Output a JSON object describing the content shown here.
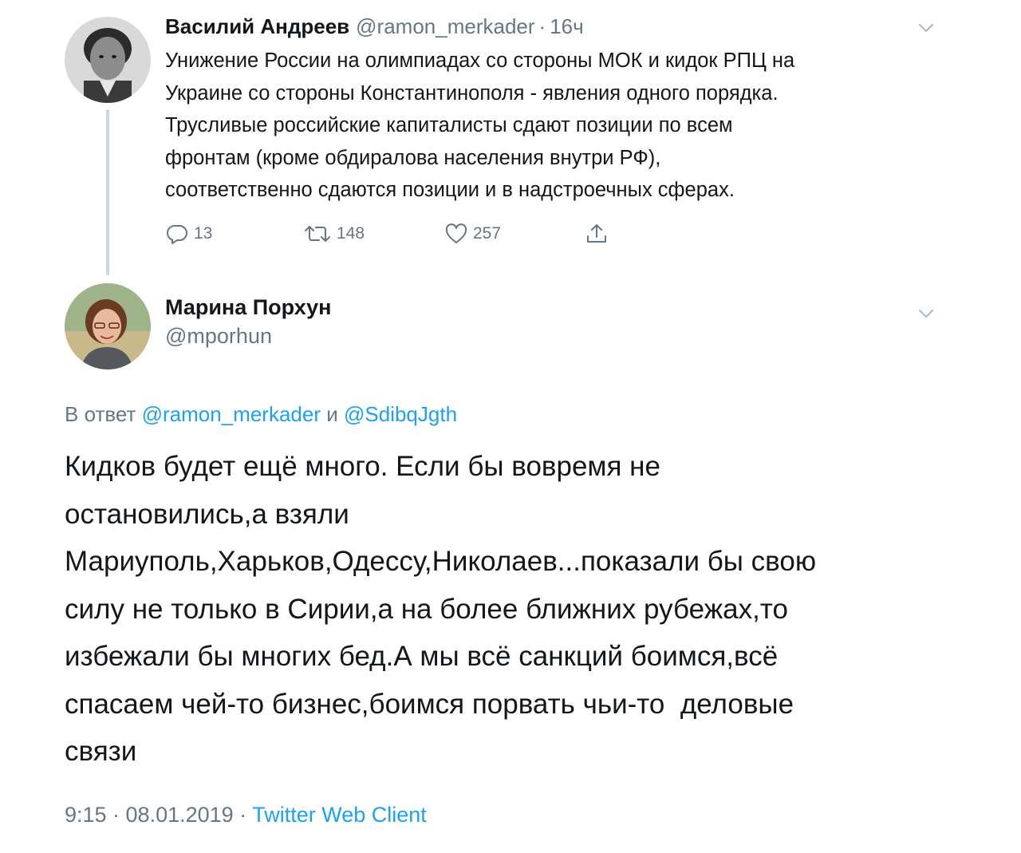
{
  "tweet1": {
    "author_name": "Василий Андреев",
    "author_handle": "@ramon_merkader",
    "separator": "·",
    "time": "16ч",
    "text_lines": [
      "Унижение России на олимпиадах со стороны МОК и кидок РПЦ на",
      "Украине со стороны Константинополя - явления одного порядка.",
      "Трусливые российские капиталисты сдают позиции по всем",
      "фронтам (кроме обдиралова населения внутри РФ),",
      "соответственно сдаются позиции и в надстроечных сферах."
    ],
    "actions": {
      "reply_count": "13",
      "retweet_count": "148",
      "like_count": "257"
    }
  },
  "tweet2": {
    "author_name": "Марина Порхун",
    "author_handle": "@mporhun",
    "reply_prefix": "В ответ",
    "reply_mention_1": "@ramon_merkader",
    "reply_conjunction": "и",
    "reply_mention_2": "@SdibqJgth",
    "text_lines": [
      "Кидков будет ещё много. Если бы вовремя не",
      "остановились,а взяли",
      "Мариуполь,Харьков,Одессу,Николаев...показали бы свою",
      "силу не только в Сирии,а на более ближних рубежах,то",
      "избежали бы многих бед.А мы всё санкций боимся,всё",
      "спасаем чей-то бизнес,боимся порвать чьи-то  деловые",
      "связи"
    ],
    "timestamp": "9:15 · 08.01.2019 ·",
    "client": "Twitter Web Client"
  },
  "icons": {
    "reply": "reply-icon",
    "retweet": "retweet-icon",
    "like": "heart-icon",
    "share": "share-icon",
    "more": "chevron-down-icon"
  },
  "colors": {
    "text": "#14171a",
    "secondary": "#657786",
    "link": "#1da1f2",
    "thread_line": "#ccd6dd"
  }
}
